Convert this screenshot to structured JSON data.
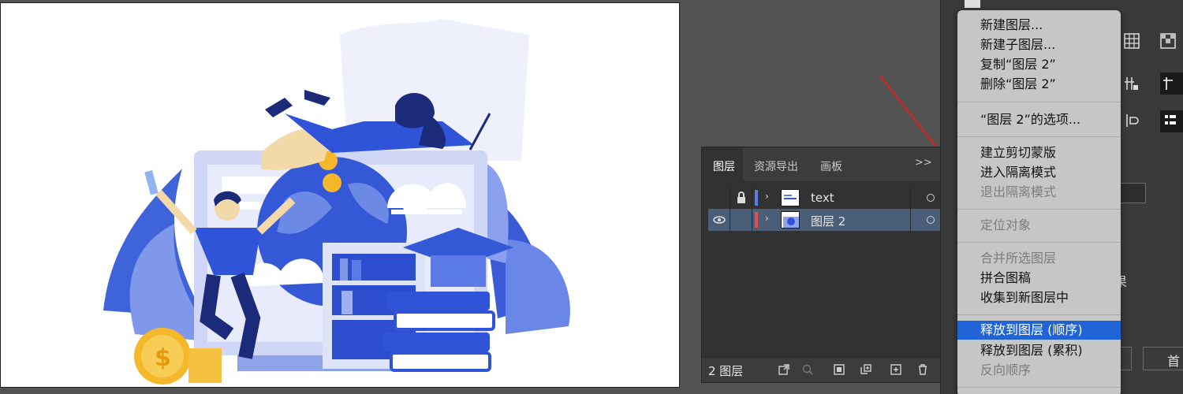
{
  "layers_panel": {
    "tabs": [
      "图层",
      "资源导出",
      "画板"
    ],
    "more": ">>",
    "layers": [
      {
        "name": "text",
        "locked": true,
        "visible": false,
        "color": "#5a7be8"
      },
      {
        "name": "图层 2",
        "locked": false,
        "visible": true,
        "color": "#e84c4c",
        "selected": true
      }
    ],
    "count_label": "2 图层"
  },
  "context_menu": {
    "groups": [
      [
        {
          "label": "新建图层...",
          "enabled": true
        },
        {
          "label": "新建子图层...",
          "enabled": true
        },
        {
          "label": "复制“图层 2”",
          "enabled": true
        },
        {
          "label": "删除“图层 2”",
          "enabled": true
        }
      ],
      [
        {
          "label": "“图层 2”的选项...",
          "enabled": true
        }
      ],
      [
        {
          "label": "建立剪切蒙版",
          "enabled": true
        },
        {
          "label": "进入隔离模式",
          "enabled": true
        },
        {
          "label": "退出隔离模式",
          "enabled": false
        }
      ],
      [
        {
          "label": "定位对象",
          "enabled": false
        }
      ],
      [
        {
          "label": "合并所选图层",
          "enabled": false
        },
        {
          "label": "拼合图稿",
          "enabled": true
        },
        {
          "label": "收集到新图层中",
          "enabled": true
        }
      ],
      [
        {
          "label": "释放到图层 (顺序)",
          "enabled": true,
          "highlighted": true
        },
        {
          "label": "释放到图层 (累积)",
          "enabled": true
        },
        {
          "label": "反向顺序",
          "enabled": false
        }
      ]
    ]
  },
  "right_panel": {
    "partial_text": "果",
    "partial_text_2": "首"
  },
  "colors": {
    "highlight": "#1f63d6",
    "annotation_arrow": "#e02020",
    "illustration_blue": "#2f54d8"
  }
}
